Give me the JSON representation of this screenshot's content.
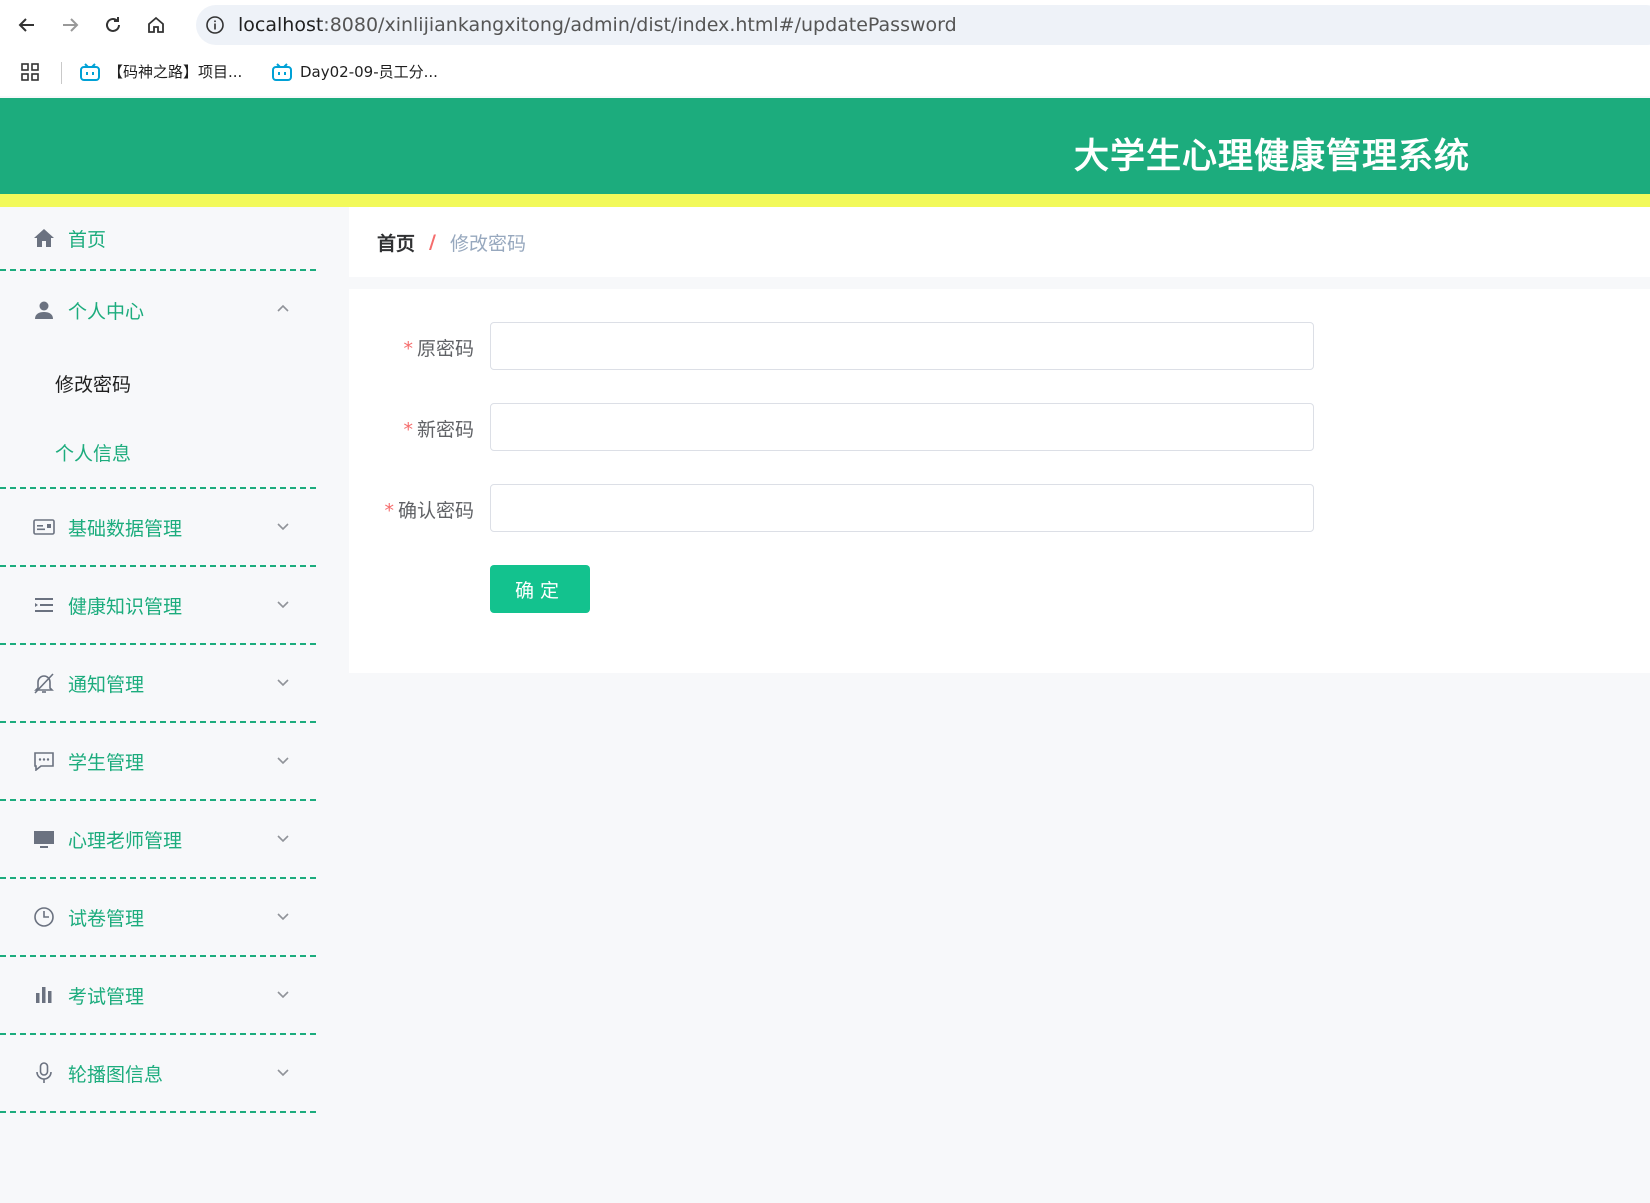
{
  "browser": {
    "url_host": "localhost",
    "url_rest": ":8080/xinlijiankangxitong/admin/dist/index.html#/updatePassword",
    "bookmarks": [
      "【码神之路】项目...",
      "Day02-09-员工分..."
    ]
  },
  "header": {
    "title": "大学生心理健康管理系统"
  },
  "sidebar": {
    "home": "首页",
    "personal_center": {
      "label": "个人中心",
      "children": [
        "修改密码",
        "个人信息"
      ]
    },
    "items": [
      {
        "label": "基础数据管理",
        "icon": "id-card-icon"
      },
      {
        "label": "健康知识管理",
        "icon": "list-icon"
      },
      {
        "label": "通知管理",
        "icon": "bell-off-icon"
      },
      {
        "label": "学生管理",
        "icon": "message-icon"
      },
      {
        "label": "心理老师管理",
        "icon": "monitor-icon"
      },
      {
        "label": "试卷管理",
        "icon": "clock-icon"
      },
      {
        "label": "考试管理",
        "icon": "bar-chart-icon"
      },
      {
        "label": "轮播图信息",
        "icon": "microphone-icon"
      }
    ]
  },
  "breadcrumb": {
    "home": "首页",
    "separator": "/",
    "current": "修改密码"
  },
  "form": {
    "required_mark": "*",
    "fields": [
      {
        "label": "原密码",
        "value": ""
      },
      {
        "label": "新密码",
        "value": ""
      },
      {
        "label": "确认密码",
        "value": ""
      }
    ],
    "submit_label": "确定"
  },
  "colors": {
    "brand": "#1cac7d",
    "stripe": "#f2f95a",
    "button": "#13c28e",
    "required": "#f56c6c"
  }
}
